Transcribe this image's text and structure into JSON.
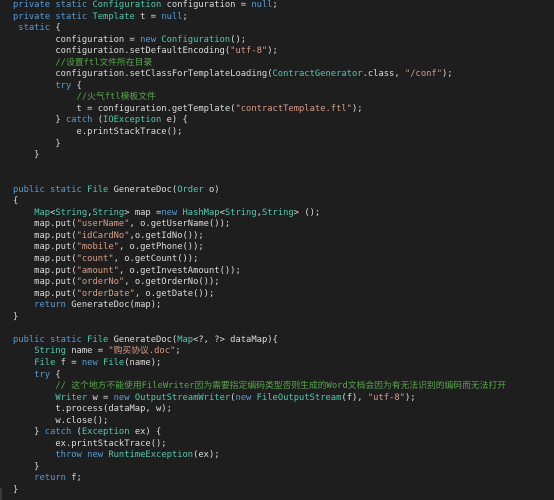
{
  "colors": {
    "background": "#1e1e1e",
    "keyword": "#569cd6",
    "type": "#4ec9b0",
    "string": "#d69d85",
    "comment": "#57a64a",
    "text": "#dcdcdc"
  },
  "lines": [
    [
      [
        "kw",
        "private static "
      ],
      [
        "ty",
        "Configuration"
      ],
      [
        "tx",
        " configuration = "
      ],
      [
        "kw",
        "null"
      ],
      [
        "tx",
        ";"
      ]
    ],
    [
      [
        "kw",
        "private static "
      ],
      [
        "ty",
        "Template"
      ],
      [
        "tx",
        " t = "
      ],
      [
        "kw",
        "null"
      ],
      [
        "tx",
        ";"
      ]
    ],
    [
      [
        "kw",
        " static"
      ],
      [
        "tx",
        " {"
      ]
    ],
    [
      [
        "tx",
        "        configuration = "
      ],
      [
        "kw",
        "new "
      ],
      [
        "ty",
        "Configuration"
      ],
      [
        "tx",
        "();"
      ]
    ],
    [
      [
        "tx",
        "        configuration.setDefaultEncoding("
      ],
      [
        "st",
        "\"utf-8\""
      ],
      [
        "tx",
        ");"
      ]
    ],
    [
      [
        "cm",
        "        //设置ftl文件所在目录"
      ]
    ],
    [
      [
        "tx",
        "        configuration.setClassForTemplateLoading("
      ],
      [
        "ty",
        "ContractGenerator"
      ],
      [
        "tx",
        ".class, "
      ],
      [
        "st",
        "\"/conf\""
      ],
      [
        "tx",
        ");"
      ]
    ],
    [
      [
        "kw",
        "        try"
      ],
      [
        "tx",
        " {"
      ]
    ],
    [
      [
        "cm",
        "            //火气ftl模板文件"
      ]
    ],
    [
      [
        "tx",
        "            t = configuration.getTemplate("
      ],
      [
        "st",
        "\"contractTemplate.ftl\""
      ],
      [
        "tx",
        ");"
      ]
    ],
    [
      [
        "tx",
        "        } "
      ],
      [
        "kw",
        "catch"
      ],
      [
        "tx",
        " ("
      ],
      [
        "ty",
        "IOException"
      ],
      [
        "tx",
        " e) {"
      ]
    ],
    [
      [
        "tx",
        "            e.printStackTrace();"
      ]
    ],
    [
      [
        "tx",
        "        }"
      ]
    ],
    [
      [
        "tx",
        "    }"
      ]
    ],
    [],
    [],
    [
      [
        "kw",
        "public static "
      ],
      [
        "ty",
        "File"
      ],
      [
        "tx",
        " GenerateDoc("
      ],
      [
        "ty",
        "Order"
      ],
      [
        "tx",
        " o)"
      ]
    ],
    [
      [
        "tx",
        "{"
      ]
    ],
    [
      [
        "tx",
        "    "
      ],
      [
        "ty",
        "Map"
      ],
      [
        "tx",
        "<"
      ],
      [
        "ty",
        "String"
      ],
      [
        "tx",
        ","
      ],
      [
        "ty",
        "String"
      ],
      [
        "tx",
        "> map ="
      ],
      [
        "kw",
        "new "
      ],
      [
        "ty",
        "HashMap"
      ],
      [
        "tx",
        "<"
      ],
      [
        "ty",
        "String"
      ],
      [
        "tx",
        ","
      ],
      [
        "ty",
        "String"
      ],
      [
        "tx",
        "> ();"
      ]
    ],
    [
      [
        "tx",
        "    map.put("
      ],
      [
        "st",
        "\"userName\""
      ],
      [
        "tx",
        ", o.getUserName());"
      ]
    ],
    [
      [
        "tx",
        "    map.put("
      ],
      [
        "st",
        "\"idCardNo\""
      ],
      [
        "tx",
        ",o.getIdNo());"
      ]
    ],
    [
      [
        "tx",
        "    map.put("
      ],
      [
        "st",
        "\"mobile\""
      ],
      [
        "tx",
        ", o.getPhone());"
      ]
    ],
    [
      [
        "tx",
        "    map.put("
      ],
      [
        "st",
        "\"count\""
      ],
      [
        "tx",
        ", o.getCount());"
      ]
    ],
    [
      [
        "tx",
        "    map.put("
      ],
      [
        "st",
        "\"amount\""
      ],
      [
        "tx",
        ", o.getInvestAmount());"
      ]
    ],
    [
      [
        "tx",
        "    map.put("
      ],
      [
        "st",
        "\"orderNo\""
      ],
      [
        "tx",
        ", o.getOrderNo());"
      ]
    ],
    [
      [
        "tx",
        "    map.put("
      ],
      [
        "st",
        "\"orderDate\""
      ],
      [
        "tx",
        ", o.getDate());"
      ]
    ],
    [
      [
        "kw",
        "    return"
      ],
      [
        "tx",
        " GenerateDoc(map);"
      ]
    ],
    [
      [
        "tx",
        "}"
      ]
    ],
    [],
    [
      [
        "kw",
        "public static "
      ],
      [
        "ty",
        "File"
      ],
      [
        "tx",
        " GenerateDoc("
      ],
      [
        "ty",
        "Map"
      ],
      [
        "tx",
        "<?, ?> dataMap){"
      ]
    ],
    [
      [
        "tx",
        "    "
      ],
      [
        "ty",
        "String"
      ],
      [
        "tx",
        " name = "
      ],
      [
        "st",
        "\"购买协议.doc\""
      ],
      [
        "tx",
        ";"
      ]
    ],
    [
      [
        "tx",
        "    "
      ],
      [
        "ty",
        "File"
      ],
      [
        "tx",
        " f = "
      ],
      [
        "kw",
        "new "
      ],
      [
        "ty",
        "File"
      ],
      [
        "tx",
        "(name);"
      ]
    ],
    [
      [
        "kw",
        "    try"
      ],
      [
        "tx",
        " {"
      ]
    ],
    [
      [
        "cm",
        "        // 这个地方不能使用FileWriter因为需要指定编码类型否则生成的Word文档会因为有无法识别的编码而无法打开"
      ]
    ],
    [
      [
        "tx",
        "        "
      ],
      [
        "ty",
        "Writer"
      ],
      [
        "tx",
        " w = "
      ],
      [
        "kw",
        "new "
      ],
      [
        "ty",
        "OutputStreamWriter"
      ],
      [
        "tx",
        "("
      ],
      [
        "kw",
        "new "
      ],
      [
        "ty",
        "FileOutputStream"
      ],
      [
        "tx",
        "(f), "
      ],
      [
        "st",
        "\"utf-8\""
      ],
      [
        "tx",
        ");"
      ]
    ],
    [
      [
        "tx",
        "        t.process(dataMap, w);"
      ]
    ],
    [
      [
        "tx",
        "        w.close();"
      ]
    ],
    [
      [
        "tx",
        "    } "
      ],
      [
        "kw",
        "catch"
      ],
      [
        "tx",
        " ("
      ],
      [
        "ty",
        "Exception"
      ],
      [
        "tx",
        " ex) {"
      ]
    ],
    [
      [
        "tx",
        "        ex.printStackTrace();"
      ]
    ],
    [
      [
        "kw",
        "        throw new "
      ],
      [
        "ty",
        "RuntimeException"
      ],
      [
        "tx",
        "(ex);"
      ]
    ],
    [
      [
        "tx",
        "    }"
      ]
    ],
    [
      [
        "kw",
        "    return"
      ],
      [
        "tx",
        " f;"
      ]
    ],
    [
      [
        "tx",
        "}"
      ]
    ]
  ]
}
